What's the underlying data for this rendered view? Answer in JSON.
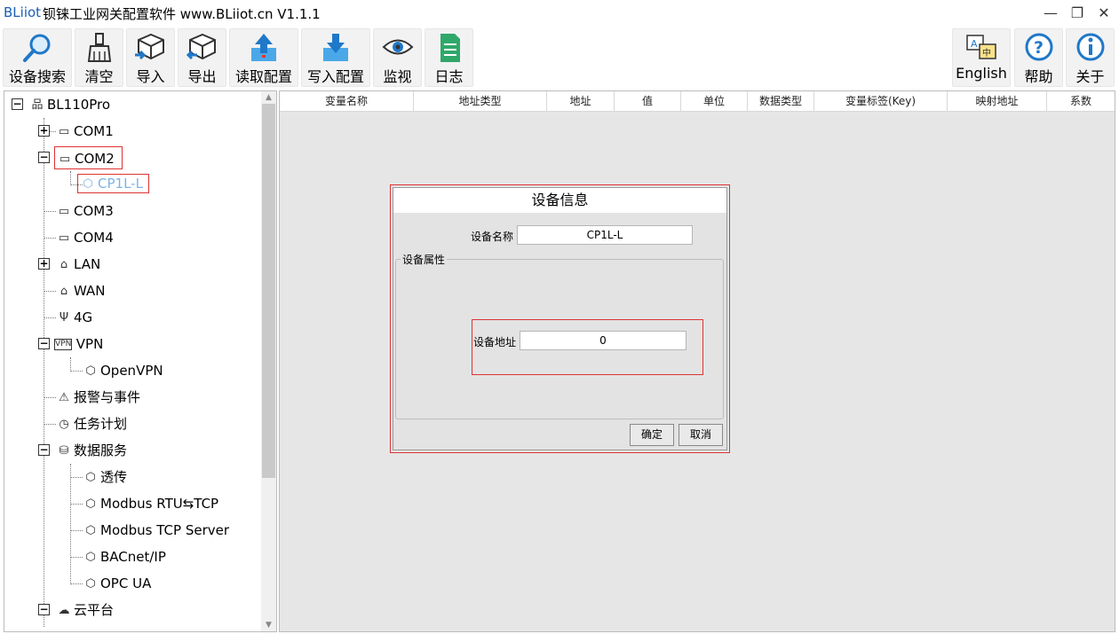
{
  "titlebar": {
    "brand": "BLiiot",
    "title": "钡铼工业网关配置软件 www.BLiiot.cn V1.1.1",
    "minimize": "—",
    "restore": "❐",
    "close": "✕"
  },
  "toolbar": {
    "device_search": "设备搜索",
    "clear": "清空",
    "import": "导入",
    "export": "导出",
    "read_config": "读取配置",
    "write_config": "写入配置",
    "monitor": "监视",
    "log": "日志",
    "english": "English",
    "help": "帮助",
    "about": "关于"
  },
  "tree": {
    "root": "BL110Pro",
    "com1": "COM1",
    "com2": "COM2",
    "cp1l": "CP1L-L",
    "com3": "COM3",
    "com4": "COM4",
    "lan": "LAN",
    "wan": "WAN",
    "g4": "4G",
    "vpn": "VPN",
    "openvpn": "OpenVPN",
    "alarm": "报警与事件",
    "task": "任务计划",
    "data_service": "数据服务",
    "transparent": "透传",
    "modbus_rtu_tcp": "Modbus RTU⇆TCP",
    "modbus_tcp_server": "Modbus TCP Server",
    "bacnet": "BACnet/IP",
    "opcua": "OPC UA",
    "cloud": "云平台"
  },
  "table": {
    "columns": [
      "变量名称",
      "地址类型",
      "地址",
      "值",
      "单位",
      "数据类型",
      "变量标签(Key)",
      "映射地址",
      "系数"
    ]
  },
  "dialog": {
    "title": "设备信息",
    "device_name_label": "设备名称",
    "device_name_value": "CP1L-L",
    "group_label": "设备属性",
    "device_address_label": "设备地址",
    "device_address_value": "0",
    "ok": "确定",
    "cancel": "取消"
  },
  "colors": {
    "brand": "#1a5fb4",
    "highlight": "#dd3333",
    "selected_text": "#7fb2e8"
  }
}
